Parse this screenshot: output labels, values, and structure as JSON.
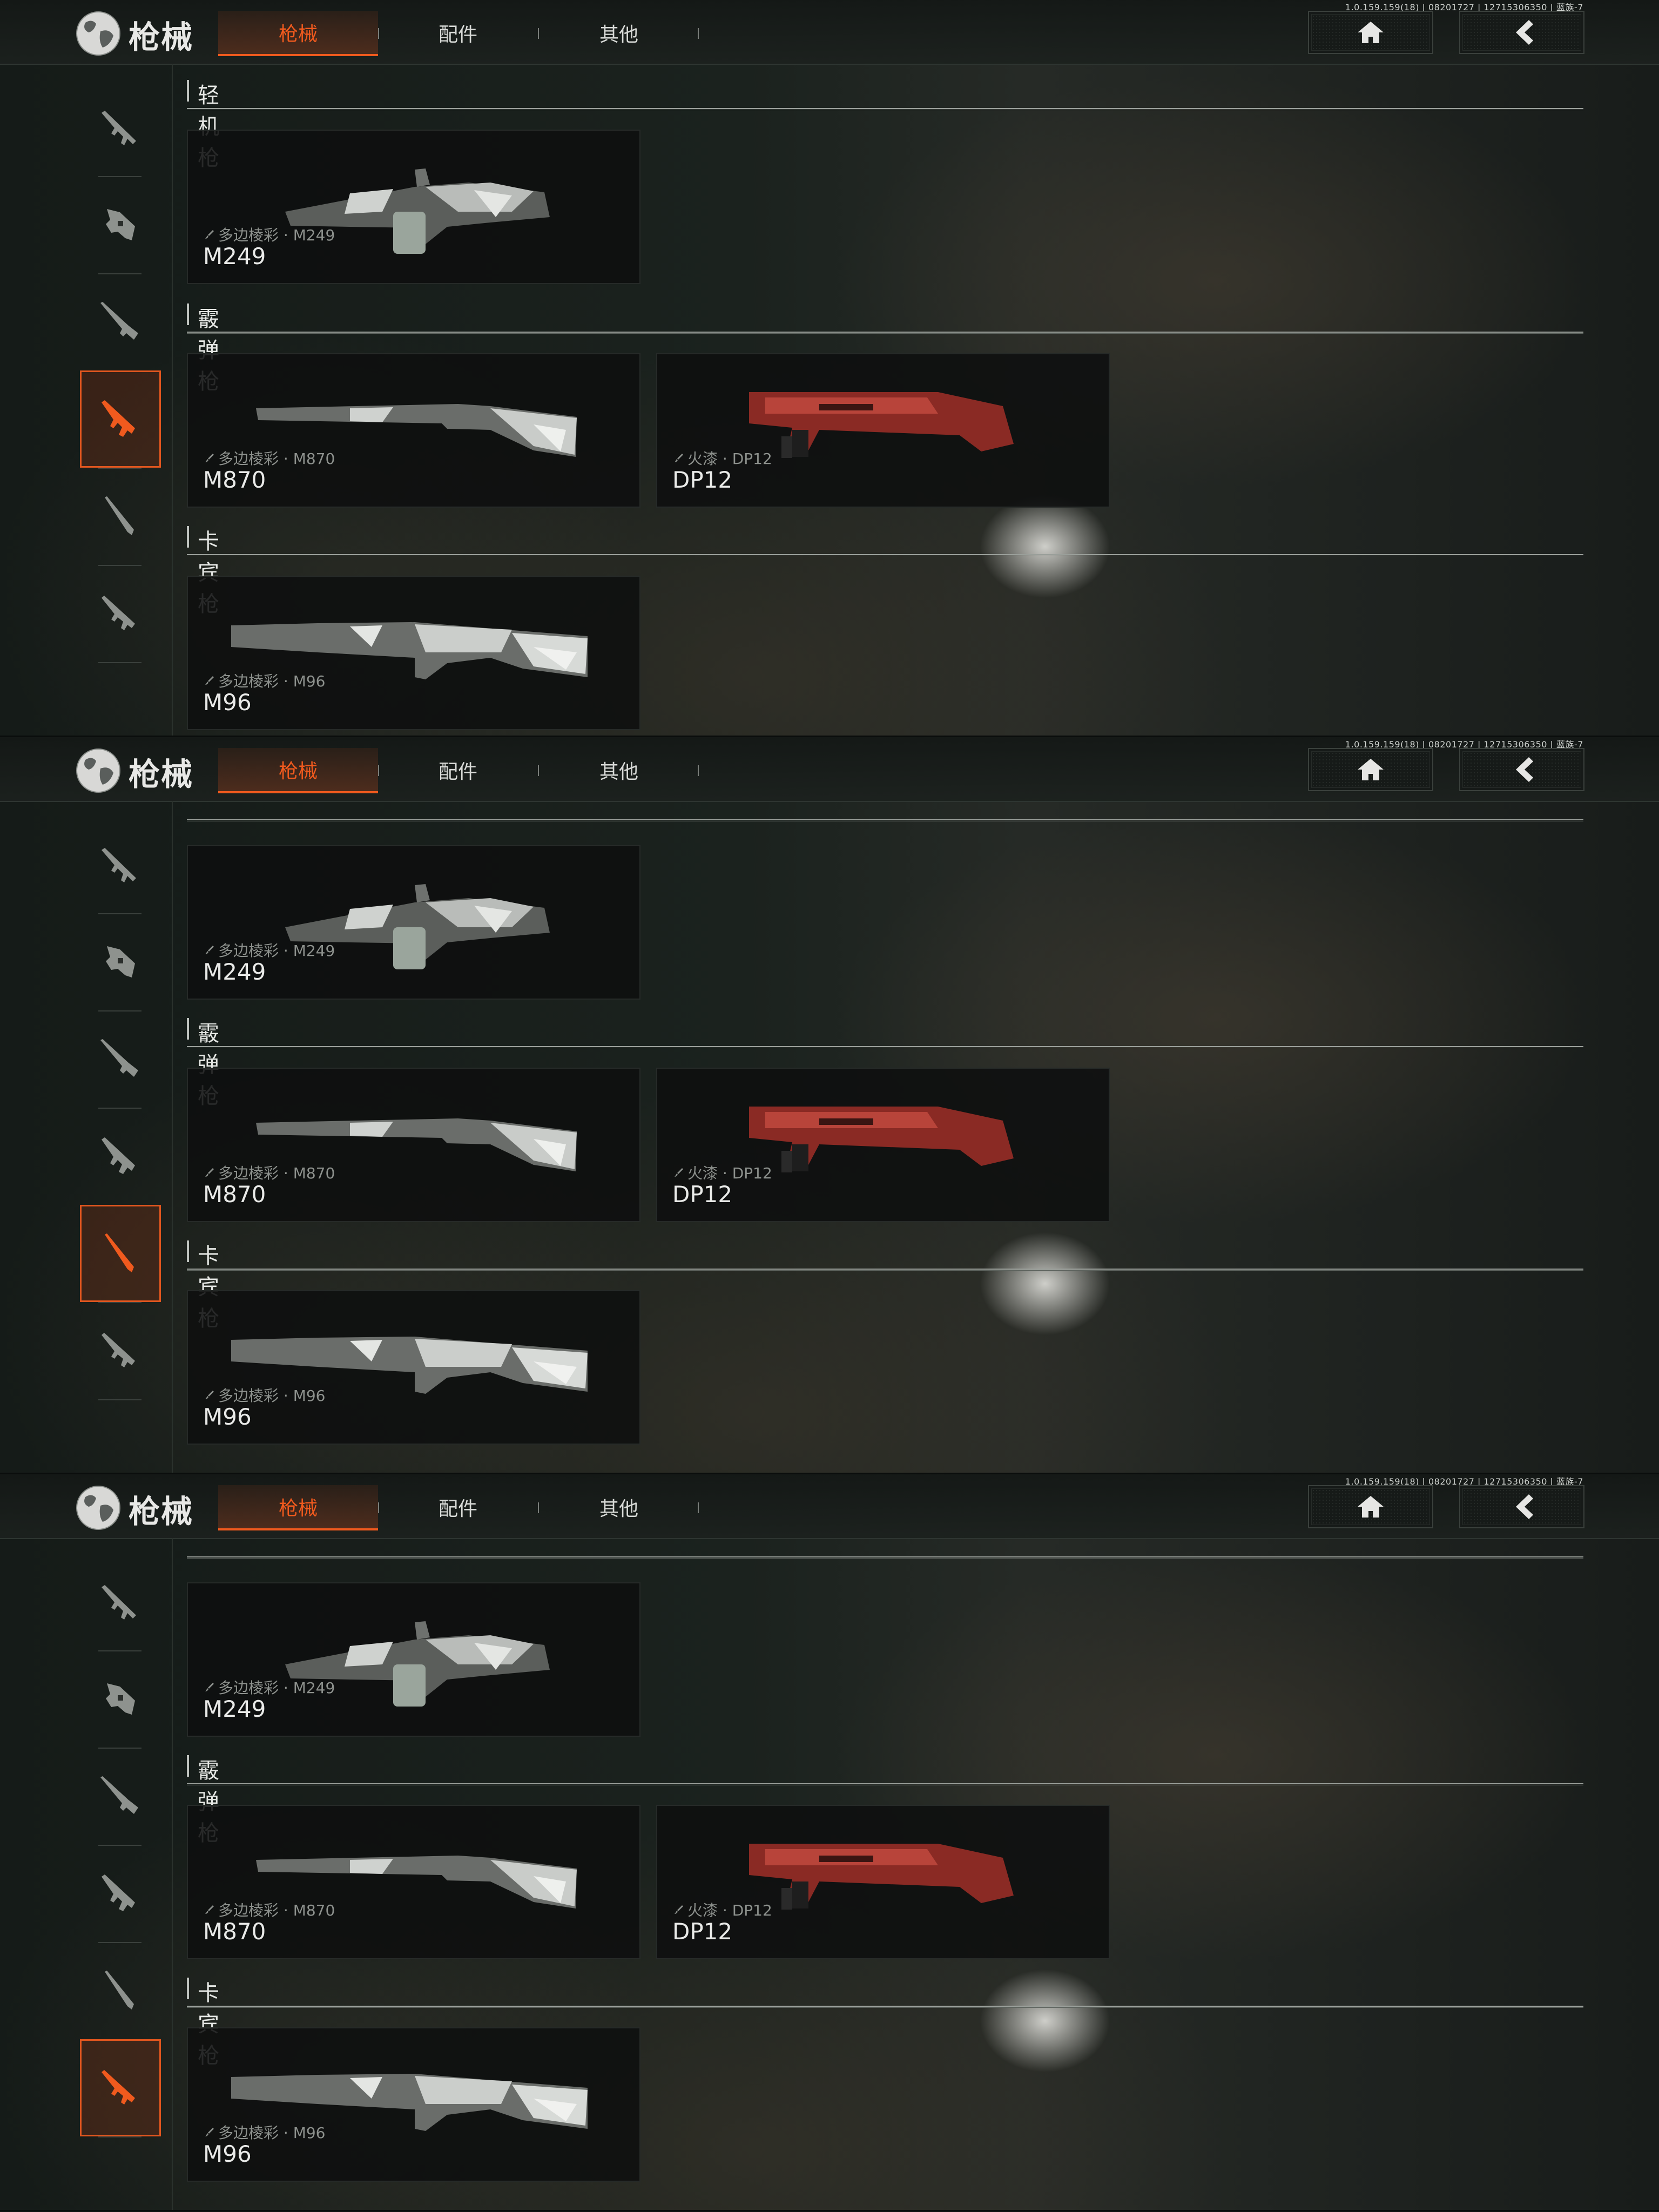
{
  "version": "1.0.159.159(18) | 08201727 | 12715306350 | 蓝族-7",
  "header": {
    "title": "枪械",
    "tabs": [
      {
        "label": "枪械",
        "active": true
      },
      {
        "label": "配件",
        "active": false
      },
      {
        "label": "其他",
        "active": false
      }
    ],
    "home_icon": "home-icon",
    "back_icon": "back-chevron-icon"
  },
  "sections": {
    "lmg": "轻机枪",
    "shotgun": "霰弹枪",
    "carbine": "卡宾枪"
  },
  "weapons": {
    "m249": {
      "name": "M249",
      "skin": "多边棱彩 · M249"
    },
    "m870": {
      "name": "M870",
      "skin": "多边棱彩 · M870"
    },
    "dp12": {
      "name": "DP12",
      "skin": "火漆 · DP12"
    },
    "m96": {
      "name": "M96",
      "skin": "多边棱彩 · M96"
    }
  },
  "sidebar": {
    "categories": [
      "assault-rifle-icon",
      "smg-icon",
      "sniper-icon",
      "lmg-icon",
      "shotgun-icon",
      "carbine-icon"
    ]
  },
  "colors": {
    "accent": "#f05a1e",
    "text": "#e9eae8",
    "card_bg": "#0e0f0f"
  }
}
